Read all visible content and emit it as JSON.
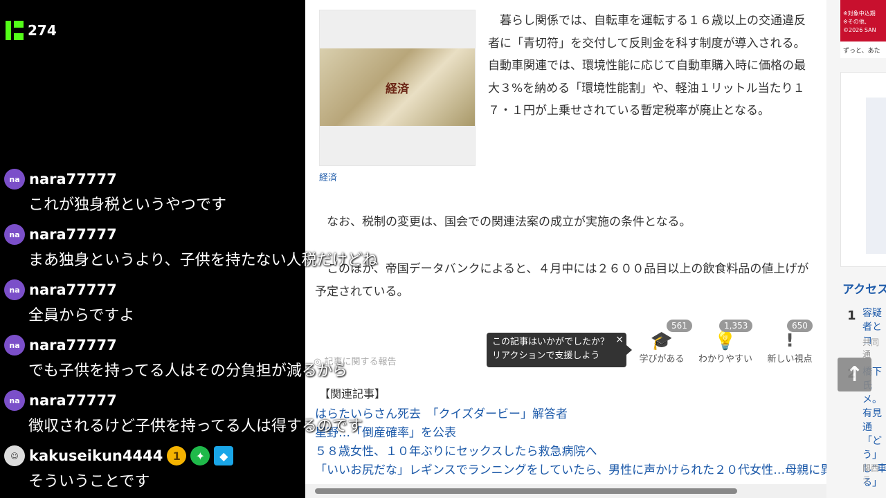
{
  "stream": {
    "viewer_count": "274",
    "chat": [
      {
        "avatar": "na",
        "user": "nara77777",
        "text": "これが独身税というやつです"
      },
      {
        "avatar": "na",
        "user": "nara77777",
        "text": "まあ独身というより、子供を持たない人税だけどね"
      },
      {
        "avatar": "na",
        "user": "nara77777",
        "text": "全員からですよ"
      },
      {
        "avatar": "na",
        "user": "nara77777",
        "text": "でも子供を持ってる人はその分負担が減るから"
      },
      {
        "avatar": "na",
        "user": "nara77777",
        "text": "徴収されるけど子供を持ってる人は得するのです"
      },
      {
        "avatar": "",
        "user": "kakuseikun4444",
        "text": "そういうことです"
      }
    ],
    "badges": [
      "1",
      "✦",
      "◆"
    ]
  },
  "article": {
    "image_label": "経済",
    "image_caption": "経済",
    "paragraph1": "暮らし関係では、自転車を運転する１６歳以上の交通違反者に「青切符」を交付して反則金を科す制度が導入される。自動車関連では、環境性能に応じて自動車購入時に価格の最大３%を納める「環境性能割」や、軽油１リットル当たり１７・１円が上乗せされている暫定税率が廃止となる。",
    "paragraph2": "なお、税制の変更は、国会での関連法案の成立が実施の条件となる。",
    "paragraph3": "このほか、帝国データバンクによると、４月中には２６００品目以上の飲食料品の値上げが予定されている。",
    "tooltip_line1": "この記事はいかがでしたか？",
    "tooltip_line2": "リアクションで支援しよう",
    "tooltip_close": "×",
    "reactions": [
      {
        "label": "学びがある",
        "count": "561"
      },
      {
        "label": "わかりやすい",
        "count": "1,353"
      },
      {
        "label": "新しい視点",
        "count": "650"
      }
    ],
    "report_label": "記事に関する報告",
    "related_heading": "【関連記事】",
    "related": [
      "はらたいらさん死去　「クイズダービー」解答者",
      "星野…「倒産確率」を公表",
      "５８歳女性、１０年ぶりにセックスしたら救急病院へ",
      "「いいお尻だな」レギンスでランニングをしていたら、男性に声かけられた２０代女性…母親に異変、まさ"
    ]
  },
  "sidebar": {
    "ad_line1": "※対象中込期",
    "ad_line2": "※その他、",
    "ad_line3": "©2026 SAN",
    "ad_tagline": "ずっと、あた",
    "access_title": "アクセスランキング",
    "ranks": [
      {
        "num": "1",
        "title": "容疑者とコ",
        "source": "共同通"
      },
      {
        "num": "2",
        "title": "橋下氏メ。有見通「どう」し”車る」",
        "source": "関西テ"
      }
    ],
    "top_button": "↑"
  }
}
